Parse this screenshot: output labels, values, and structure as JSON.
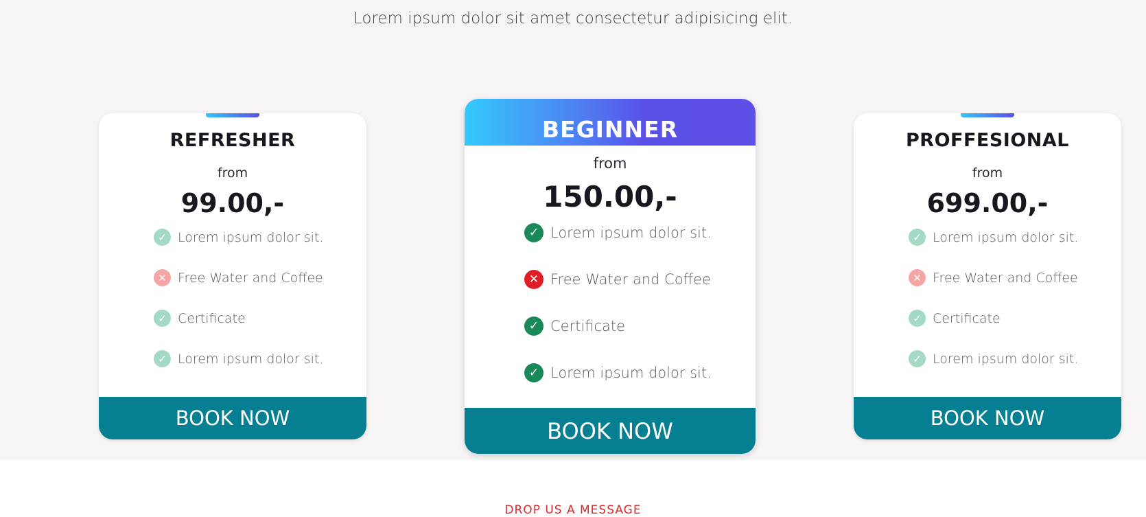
{
  "subtitle": "Lorem ipsum dolor sit amet consectetur adipisicing elit.",
  "plans": [
    {
      "name": "REFRESHER",
      "from_label": "from",
      "price": "99.00,-",
      "features": [
        {
          "text": "Lorem ipsum dolor sit.",
          "status": "check-icon"
        },
        {
          "text": "Free Water and Coffee",
          "status": "cross-icon"
        },
        {
          "text": "Certificate",
          "status": "check-icon"
        },
        {
          "text": "Lorem ipsum dolor sit.",
          "status": "check-icon"
        }
      ],
      "button_label": "BOOK NOW"
    },
    {
      "name": "BEGINNER",
      "from_label": "from",
      "price": "150.00,-",
      "features": [
        {
          "text": "Lorem ipsum dolor sit.",
          "status": "check-icon"
        },
        {
          "text": "Free Water and Coffee",
          "status": "cross-icon"
        },
        {
          "text": "Certificate",
          "status": "check-icon"
        },
        {
          "text": "Lorem ipsum dolor sit.",
          "status": "check-icon"
        }
      ],
      "button_label": "BOOK NOW"
    },
    {
      "name": "PROFFESIONAL",
      "from_label": "from",
      "price": "699.00,-",
      "features": [
        {
          "text": "Lorem ipsum dolor sit.",
          "status": "check-icon"
        },
        {
          "text": "Free Water and Coffee",
          "status": "cross-icon"
        },
        {
          "text": "Certificate",
          "status": "check-icon"
        },
        {
          "text": "Lorem ipsum dolor sit.",
          "status": "check-icon"
        }
      ],
      "button_label": "BOOK NOW"
    }
  ],
  "bottom_link": "DROP US A MESSAGE",
  "colors": {
    "section_bg": "#f6f4f5",
    "button_bg": "#077f92",
    "gradient_start": "#33c4f6",
    "gradient_end": "#5a50e8",
    "check_featured": "#198a57",
    "cross_featured": "#df1f25",
    "check_muted": "#a4d9c4",
    "cross_muted": "#f4a6a4"
  }
}
